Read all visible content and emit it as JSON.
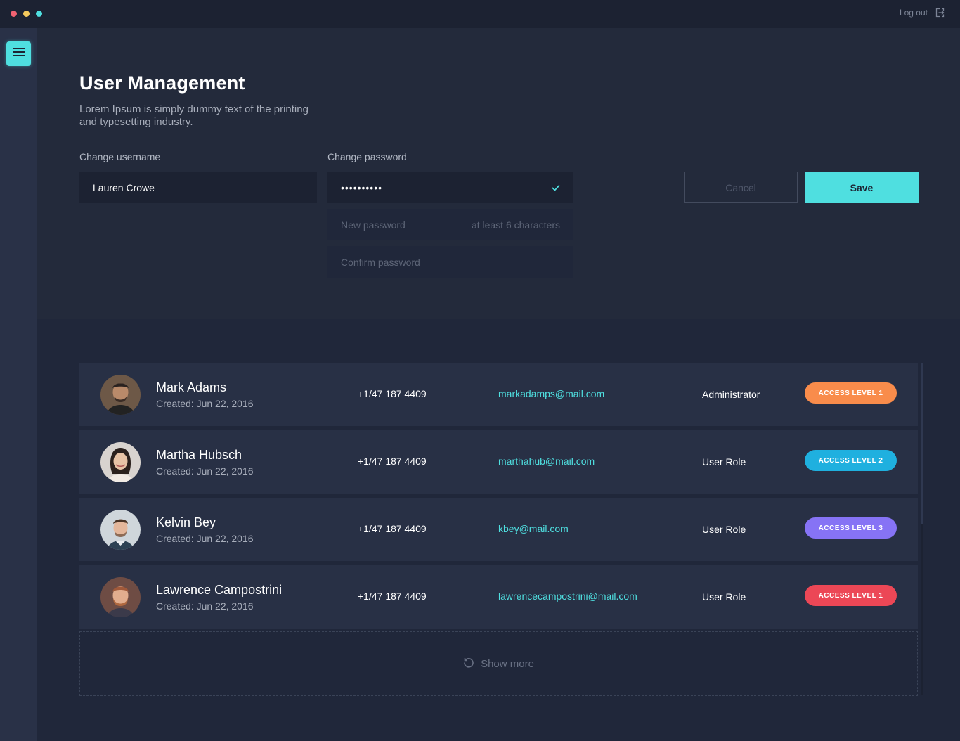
{
  "window": {
    "logout_label": "Log out"
  },
  "header": {
    "title": "User Management",
    "description": "Lorem Ipsum is simply dummy text of the printing and typesetting industry."
  },
  "form": {
    "username_label": "Change username",
    "username_value": "Lauren Crowe",
    "password_label": "Change password",
    "password_value": "••••••••••",
    "new_password_placeholder": "New password",
    "new_password_hint": "at least 6 characters",
    "confirm_password_placeholder": "Confirm password",
    "cancel_label": "Cancel",
    "save_label": "Save"
  },
  "users": [
    {
      "name": "Mark Adams",
      "created": "Created: Jun 22, 2016",
      "phone": "+1/47 187 4409",
      "email": "markadamps@mail.com",
      "role": "Administrator",
      "badge": "ACCESS LEVEL 1",
      "badge_color": "#f98c4b"
    },
    {
      "name": "Martha Hubsch",
      "created": "Created: Jun 22, 2016",
      "phone": "+1/47 187 4409",
      "email": "marthahub@mail.com",
      "role": "User Role",
      "badge": "ACCESS LEVEL 2",
      "badge_color": "#1fb0df"
    },
    {
      "name": "Kelvin Bey",
      "created": "Created: Jun 22, 2016",
      "phone": "+1/47 187 4409",
      "email": "kbey@mail.com",
      "role": "User Role",
      "badge": "ACCESS LEVEL 3",
      "badge_color": "#8673f5"
    },
    {
      "name": "Lawrence Campostrini",
      "created": "Created: Jun 22, 2016",
      "phone": "+1/47 187 4409",
      "email": "lawrencecampostrini@mail.com",
      "role": "User Role",
      "badge": "ACCESS LEVEL 1",
      "badge_color": "#ec4756"
    }
  ],
  "show_more_label": "Show more",
  "colors": {
    "accent": "#4fdfe0",
    "background": "#20273a",
    "card": "#283045"
  }
}
